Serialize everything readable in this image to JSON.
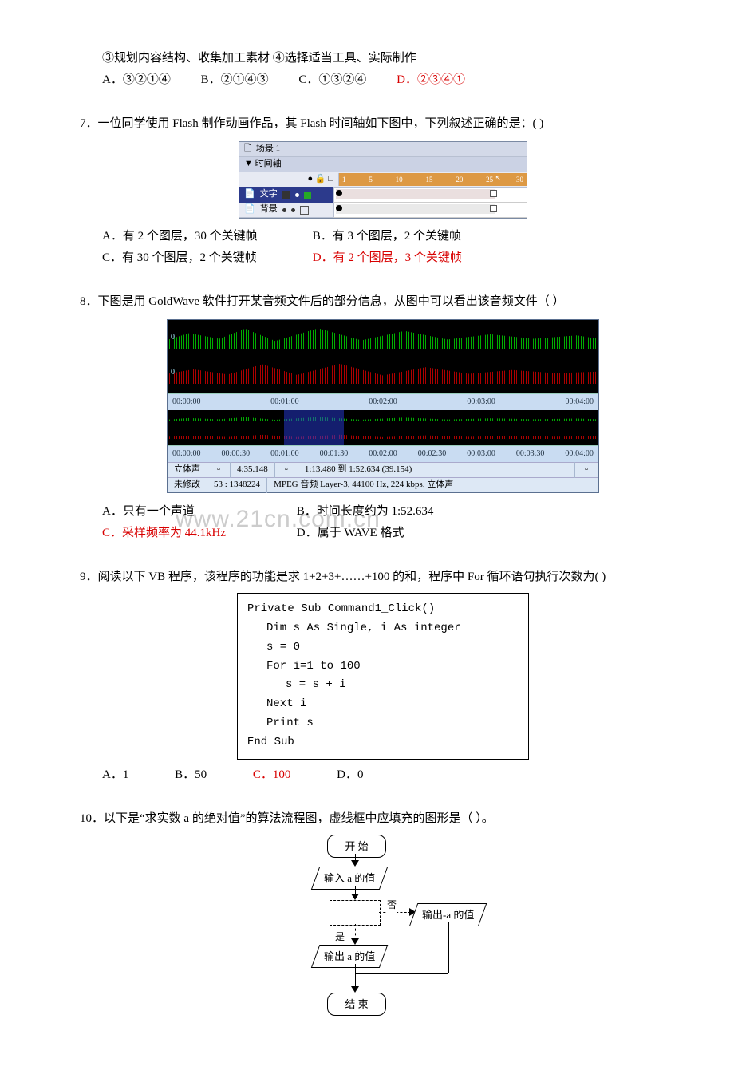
{
  "q6": {
    "line1": "③规划内容结构、收集加工素材     ④选择适当工具、实际制作",
    "A": "A．③②①④",
    "B": "B．②①④③",
    "C": "C．①③②④",
    "D": "D．②③④①"
  },
  "q7": {
    "stem": "7．一位同学使用 Flash 制作动画作品，其 Flash 时间轴如下图中，下列叙述正确的是：(  )",
    "flash": {
      "scene": "场景 1",
      "panel": "▼ 时间轴",
      "icons": "● 🔒 □",
      "ruler": [
        "1",
        "5",
        "10",
        "15",
        "20",
        "25",
        "30"
      ],
      "layer1": "文字",
      "layer2": "背景"
    },
    "A": "A．有 2 个图层，30 个关键帧",
    "B": "B．有 3 个图层，2 个关键帧",
    "C": "C．有 30 个图层，2 个关键帧",
    "D": "D．有 2 个图层，3 个关键帧"
  },
  "q8": {
    "stem": "8．下图是用 GoldWave 软件打开某音频文件后的部分信息，从图中可以看出该音频文件（    ）",
    "ruler1": [
      "00:00:00",
      "00:01:00",
      "00:02:00",
      "00:03:00",
      "00:04:00"
    ],
    "ruler2": [
      "00:00:00",
      "00:00:30",
      "00:01:00",
      "00:01:30",
      "00:02:00",
      "00:02:30",
      "00:03:00",
      "00:03:30",
      "00:04:00"
    ],
    "bar1": {
      "c1": "立体声",
      "c2": "4:35.148",
      "c3": "1:13.480 到 1:52.634 (39.154)"
    },
    "bar2": {
      "c1": "未修改",
      "c2": "53 : 1348224",
      "c3": "MPEG 音频 Layer-3, 44100 Hz, 224 kbps, 立体声"
    },
    "A": "A．只有一个声道",
    "B": "B．时间长度约为 1:52.634",
    "C": "C．采样频率为 44.1kHz",
    "D": "D．属于 WAVE 格式",
    "wm": "www.21cn.com.cn",
    "zero": "0"
  },
  "q9": {
    "stem": "9．阅读以下 VB 程序，该程序的功能是求 1+2+3+……+100 的和，程序中 For 循环语句执行次数为(     )",
    "code": {
      "l1": "Private Sub Command1_Click()",
      "l2": "Dim s As Single, i As integer",
      "l3": "s = 0",
      "l4": "For i=1 to 100",
      "l5": "s = s + i",
      "l6": "Next i",
      "l7": "Print s",
      "l8": "End Sub"
    },
    "A": "A．1",
    "B": "B．50",
    "C": "C．100",
    "D": "D．0"
  },
  "q10": {
    "stem": "10．以下是“求实数 a 的绝对值”的算法流程图，虚线框中应填充的图形是（    ）。",
    "fc": {
      "start": "开 始",
      "input": "输入 a 的值",
      "no": "否",
      "yes": "是",
      "outneg": "输出-a 的值",
      "outpos": "输出 a 的值",
      "end": "结 束"
    }
  }
}
